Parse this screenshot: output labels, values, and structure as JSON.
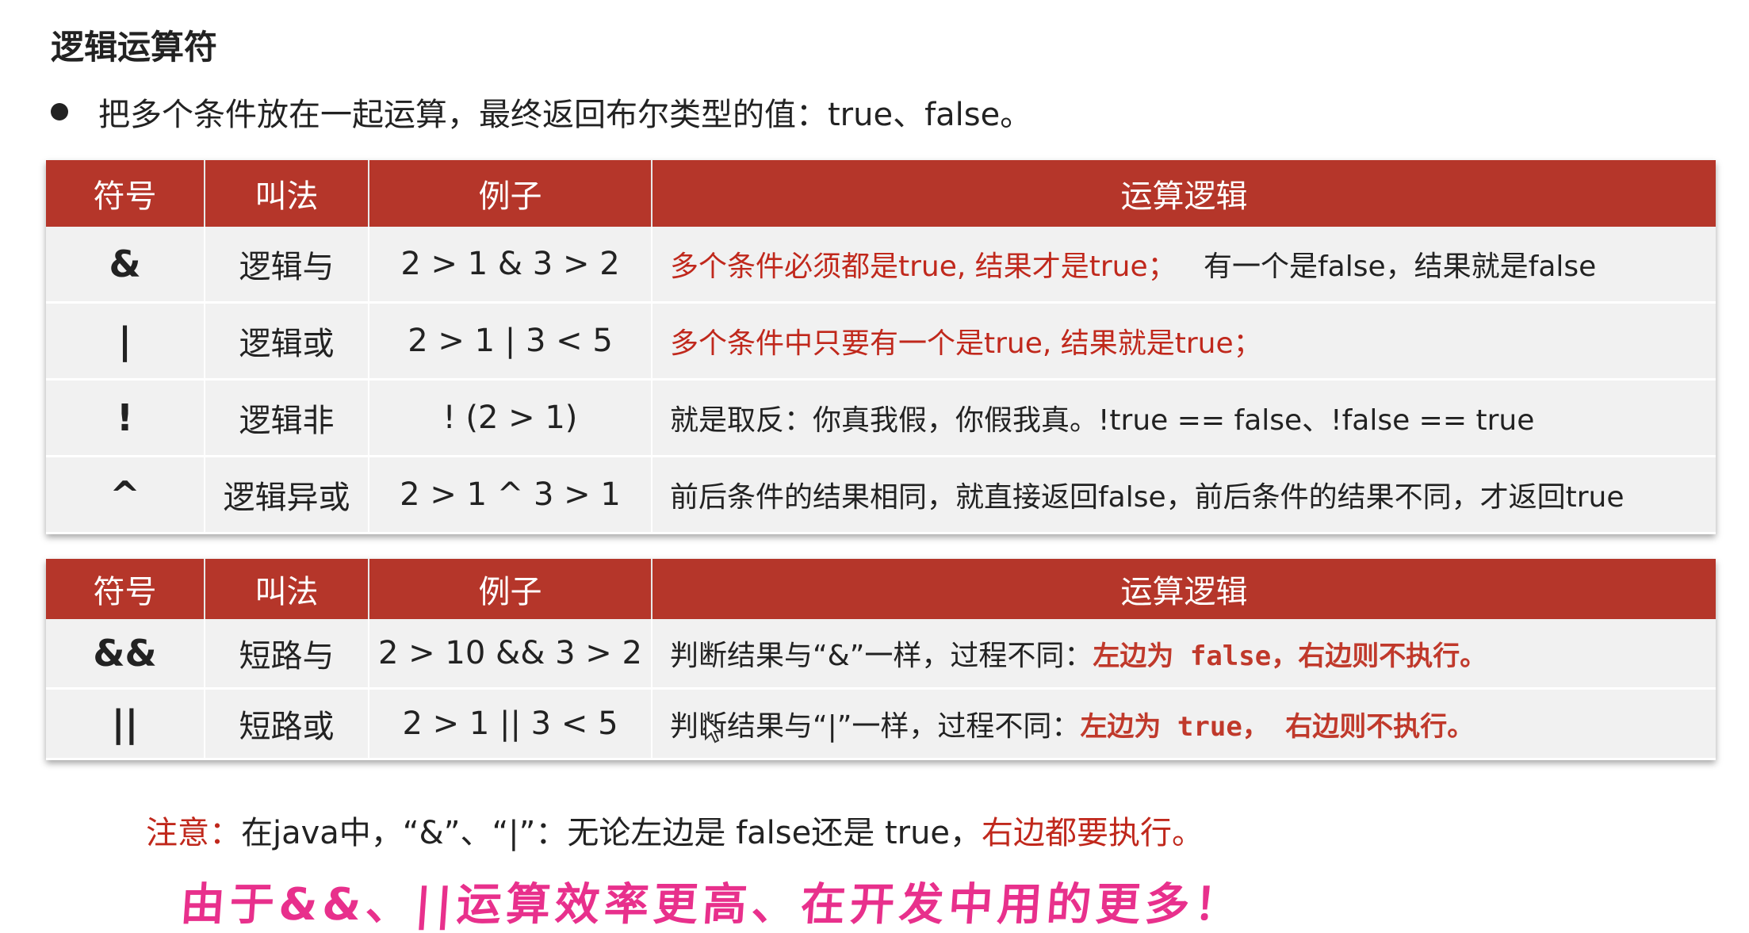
{
  "title": "逻辑运算符",
  "bullet": "把多个条件放在一起运算，最终返回布尔类型的值：true、false。",
  "colors": {
    "header_bg": "#b5362a",
    "accent_red": "#c0281c",
    "handwriting": "#e8308c"
  },
  "table1": {
    "headers": [
      "符号",
      "叫法",
      "例子",
      "运算逻辑"
    ],
    "rows": [
      {
        "symbol": "&",
        "name": "逻辑与",
        "example": "2 > 1 & 3 > 2",
        "logic_red": "多个条件必须都是true, 结果才是true；",
        "logic_black": "有一个是false，结果就是false"
      },
      {
        "symbol": "|",
        "name": "逻辑或",
        "example": "2 > 1 |  3 < 5",
        "logic_red": "多个条件中只要有一个是true, 结果就是true；",
        "logic_black": ""
      },
      {
        "symbol": "!",
        "name": "逻辑非",
        "example": "! (2 > 1)",
        "logic_red": "",
        "logic_black": "就是取反：你真我假，你假我真。!true == false、!false == true"
      },
      {
        "symbol": "^",
        "name": "逻辑异或",
        "example": "2 > 1 ^ 3 > 1",
        "logic_red": "",
        "logic_black": "前后条件的结果相同，就直接返回false，前后条件的结果不同，才返回true"
      }
    ]
  },
  "table2": {
    "headers": [
      "符号",
      "叫法",
      "例子",
      "运算逻辑"
    ],
    "rows": [
      {
        "symbol": "&&",
        "name": "短路与",
        "example": "2 > 10 && 3 > 2",
        "logic_black": "判断结果与“&”一样，过程不同：",
        "logic_red": "左边为 false，右边则不执行。"
      },
      {
        "symbol": "||",
        "name": "短路或",
        "example": "2 > 1 || 3 < 5",
        "logic_black": "判断结果与“|”一样，过程不同：",
        "logic_red": "左边为 true， 右边则不执行。"
      }
    ]
  },
  "note": {
    "label": "注意：",
    "text": "在java中，“&”、“|”：无论左边是 false还是 true，",
    "emphasis": "右边都要执行。"
  },
  "handwriting": "由于&&、||运算效率更高、在开发中用的更多！"
}
